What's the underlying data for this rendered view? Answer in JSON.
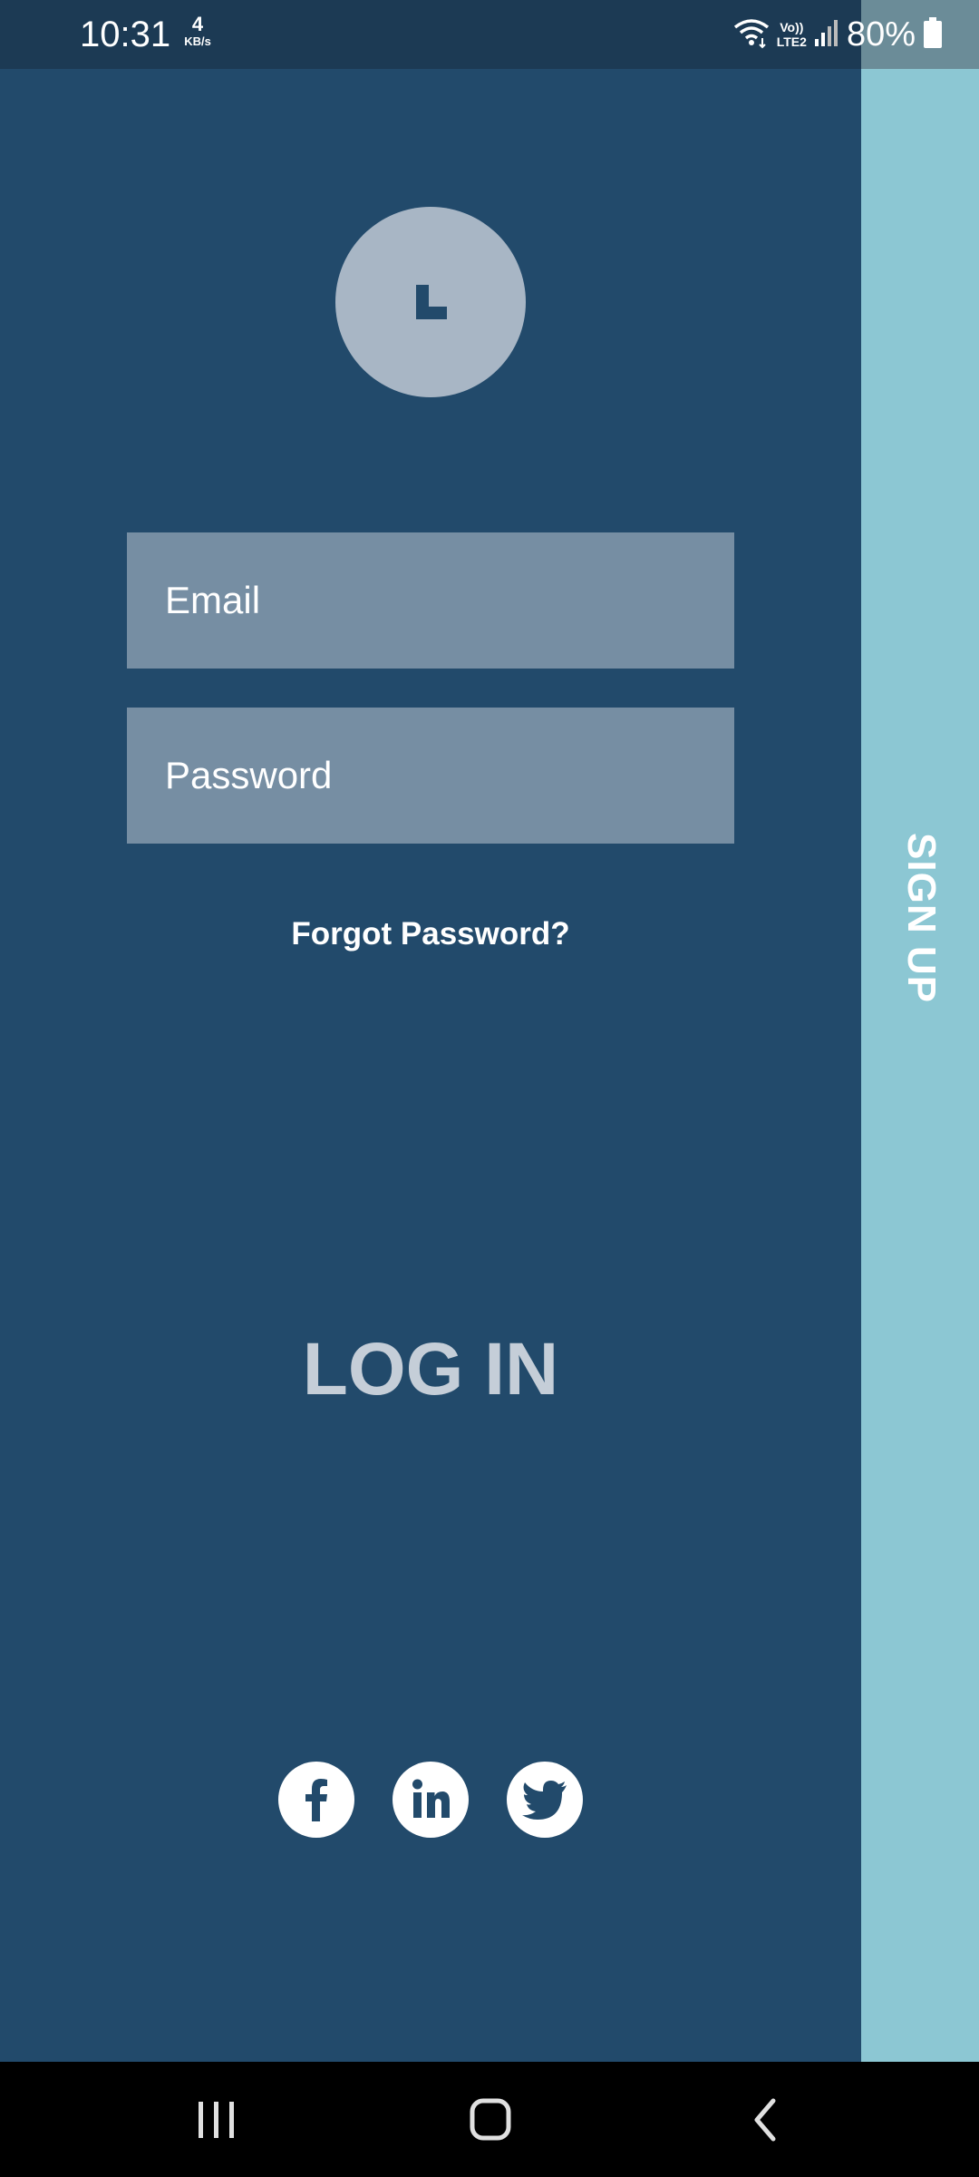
{
  "status_bar": {
    "time": "10:31",
    "net_speed_value": "4",
    "net_speed_unit": "KB/s",
    "volte_top": "Vo))",
    "volte_bottom": "LTE2",
    "battery_percent": "80%"
  },
  "login": {
    "logo_letter": "L",
    "email_placeholder": "Email",
    "password_placeholder": "Password",
    "forgot_password": "Forgot Password?",
    "login_label": "LOG IN"
  },
  "signup": {
    "label": "SIGN UP"
  },
  "social": [
    {
      "name": "facebook",
      "icon": "facebook-icon"
    },
    {
      "name": "linkedin",
      "icon": "linkedin-icon"
    },
    {
      "name": "twitter",
      "icon": "twitter-icon"
    }
  ],
  "colors": {
    "background": "#224a6b",
    "signup_panel": "#8cc7d3",
    "input_fill": "#768ea3",
    "logo_circle": "#a8b6c5",
    "login_text": "#c5ced8"
  }
}
